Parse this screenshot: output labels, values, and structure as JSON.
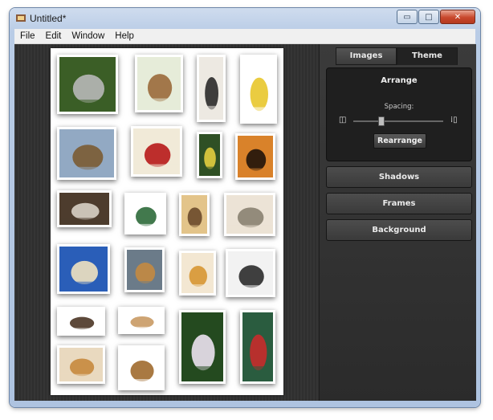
{
  "window": {
    "title": "Untitled*",
    "buttons": {
      "minimize": "▭",
      "maximize": "□",
      "close": "✕"
    }
  },
  "menu": {
    "items": [
      "File",
      "Edit",
      "Window",
      "Help"
    ]
  },
  "panel": {
    "tabs": [
      {
        "label": "Images",
        "active": false
      },
      {
        "label": "Theme",
        "active": true
      }
    ],
    "arrange": {
      "title": "Arrange",
      "spacing_label": "Spacing:",
      "spacing_value": 0.3,
      "rearrange_label": "Rearrange"
    },
    "sections": [
      "Shadows",
      "Frames",
      "Background"
    ]
  },
  "photos": [
    {
      "subject": "kitten in grass",
      "bg": "#3b5e26",
      "fg": "#b8b8b8"
    },
    {
      "subject": "bird in cage",
      "bg": "#e6ecd9",
      "fg": "#9a6a3a"
    },
    {
      "subject": "kittens on blanket",
      "bg": "#ede9e2",
      "fg": "#2a2a2a"
    },
    {
      "subject": "colorful cake",
      "bg": "#ffffff",
      "fg": "#e8c72c"
    },
    {
      "subject": "duck on water",
      "bg": "#92a9c3",
      "fg": "#7b5b33"
    },
    {
      "subject": "berry tart",
      "bg": "#f1ead8",
      "fg": "#b71a1a"
    },
    {
      "subject": "lemon tree",
      "bg": "#2f5025",
      "fg": "#e3cd3f"
    },
    {
      "subject": "sunset silhouette",
      "bg": "#d9822a",
      "fg": "#1f130a"
    },
    {
      "subject": "cat with flowers",
      "bg": "#4d3c2d",
      "fg": "#d8d0c5"
    },
    {
      "subject": "electric guitar",
      "bg": "#ffffff",
      "fg": "#2d6a3a"
    },
    {
      "subject": "tabby kitten",
      "bg": "#e3c48a",
      "fg": "#6a4a2a"
    },
    {
      "subject": "elephants",
      "bg": "#ece3d6",
      "fg": "#8a8171"
    },
    {
      "subject": "ice cream bar",
      "bg": "#2a5eb8",
      "fg": "#f0e2c0"
    },
    {
      "subject": "cat at window",
      "bg": "#6b7b89",
      "fg": "#c48a41"
    },
    {
      "subject": "breakfast plate",
      "bg": "#f3e7d2",
      "fg": "#d79632"
    },
    {
      "subject": "sneakers",
      "bg": "#f2f2f2",
      "fg": "#2b2b2b"
    },
    {
      "subject": "puppy",
      "bg": "#ffffff",
      "fg": "#4b3525"
    },
    {
      "subject": "piggy bank",
      "bg": "#ffffff",
      "fg": "#c99a64"
    },
    {
      "subject": "white orchid",
      "bg": "#244a1f",
      "fg": "#ece2ef"
    },
    {
      "subject": "christmas ornaments",
      "bg": "#2a5c3f",
      "fg": "#c62b2b"
    },
    {
      "subject": "pie",
      "bg": "#e9d9bf",
      "fg": "#c6883d"
    },
    {
      "subject": "bass guitar",
      "bg": "#ffffff",
      "fg": "#a06a2d"
    }
  ]
}
